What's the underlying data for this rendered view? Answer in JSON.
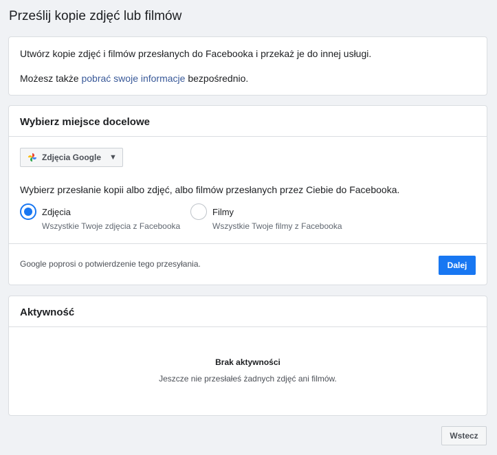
{
  "page": {
    "title": "Prześlij kopie zdjęć lub filmów"
  },
  "intro": {
    "line1": "Utwórz kopie zdjęć i filmów przesłanych do Facebooka i przekaż je do innej usługi.",
    "line2_prefix": "Możesz także ",
    "line2_link": "pobrać swoje informacje",
    "line2_suffix": " bezpośrednio."
  },
  "destination": {
    "header": "Wybierz miejsce docelowe",
    "service_label": "Zdjęcia Google",
    "service_icon": "google-photos-icon",
    "choose_text": "Wybierz przesłanie kopii albo zdjęć, albo filmów przesłanych przez Ciebie do Facebooka.",
    "options": [
      {
        "label": "Zdjęcia",
        "sub": "Wszystkie Twoje zdjęcia z Facebooka",
        "checked": true
      },
      {
        "label": "Filmy",
        "sub": "Wszystkie Twoje filmy z Facebooka",
        "checked": false
      }
    ],
    "footer_note": "Google poprosi o potwierdzenie tego przesyłania.",
    "next_label": "Dalej"
  },
  "activity": {
    "header": "Aktywność",
    "empty_title": "Brak aktywności",
    "empty_text": "Jeszcze nie przesłałeś żadnych zdjęć ani filmów."
  },
  "back_label": "Wstecz",
  "colors": {
    "accent": "#1877f2",
    "link": "#385898",
    "background": "#f0f2f5"
  }
}
